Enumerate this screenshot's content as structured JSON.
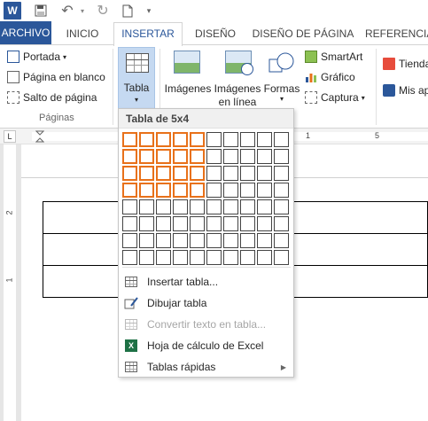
{
  "qat": {
    "app_icon": "W",
    "icons": [
      "word-app-icon",
      "save-icon",
      "undo-icon",
      "redo-icon",
      "new-document-icon"
    ]
  },
  "tabs": [
    {
      "label": "ARCHIVO",
      "active": false
    },
    {
      "label": "INICIO",
      "active": false
    },
    {
      "label": "INSERTAR",
      "active": true
    },
    {
      "label": "DISEÑO",
      "active": false
    },
    {
      "label": "DISEÑO DE PÁGINA",
      "active": false
    },
    {
      "label": "REFERENCIAS",
      "active": false
    }
  ],
  "ribbon": {
    "paginas": {
      "portada": "Portada",
      "pagina_en_blanco": "Página en blanco",
      "salto_de_pagina": "Salto de página",
      "group_label": "Páginas"
    },
    "tabla": {
      "label": "Tabla"
    },
    "ilustraciones": {
      "imagenes": "Imágenes",
      "imagenes_en_linea_1": "Imágenes",
      "imagenes_en_linea_2": "en línea",
      "formas": "Formas",
      "smartart": "SmartArt",
      "grafico": "Gráfico",
      "captura": "Captura"
    },
    "aplicaciones": {
      "tienda": "Tienda",
      "mis_apps": "Mis ap"
    }
  },
  "ruler": {
    "numbers": [
      "1",
      "5"
    ],
    "vnumbers": [
      "2",
      "1"
    ]
  },
  "menu": {
    "header": "Tabla de 5x4",
    "grid": {
      "cols": 10,
      "rows": 8,
      "selected_cols": 5,
      "selected_rows": 4
    },
    "items": [
      {
        "label": "Insertar tabla...",
        "icon": "table-icon",
        "disabled": false
      },
      {
        "label": "Dibujar tabla",
        "icon": "draw-table-icon",
        "disabled": false
      },
      {
        "label": "Convertir texto en tabla...",
        "icon": "convert-text-table-icon",
        "disabled": true
      },
      {
        "label": "Hoja de cálculo de Excel",
        "icon": "excel-icon",
        "disabled": false
      },
      {
        "label": "Tablas rápidas",
        "icon": "quick-tables-icon",
        "disabled": false,
        "submenu": true
      }
    ]
  },
  "colors": {
    "accent": "#2b579a",
    "grid_selected": "#e8711a",
    "tabla_button_bg": "#c5d9f1"
  }
}
